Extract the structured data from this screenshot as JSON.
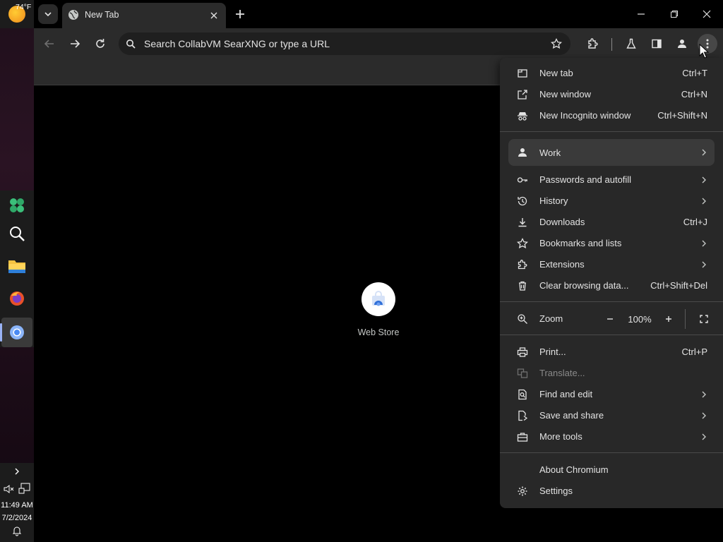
{
  "taskbar": {
    "weather_temp": "74°F",
    "time": "11:49 AM",
    "date": "7/2/2024"
  },
  "browser": {
    "tab_title": "New Tab",
    "omnibox_placeholder": "Search CollabVM SearXNG or type a URL"
  },
  "content": {
    "shortcuts": [
      {
        "label": "Web Store",
        "icon": "web-store-icon"
      }
    ]
  },
  "menu": {
    "items": [
      {
        "label": "New tab",
        "shortcut": "Ctrl+T",
        "icon": "new-tab-icon"
      },
      {
        "label": "New window",
        "shortcut": "Ctrl+N",
        "icon": "new-window-icon"
      },
      {
        "label": "New Incognito window",
        "shortcut": "Ctrl+Shift+N",
        "icon": "incognito-icon"
      },
      {
        "label": "Work",
        "icon": "person-icon",
        "submenu": true
      },
      {
        "label": "Passwords and autofill",
        "icon": "key-icon",
        "submenu": true
      },
      {
        "label": "History",
        "icon": "history-icon",
        "submenu": true
      },
      {
        "label": "Downloads",
        "shortcut": "Ctrl+J",
        "icon": "download-icon"
      },
      {
        "label": "Bookmarks and lists",
        "icon": "star-icon",
        "submenu": true
      },
      {
        "label": "Extensions",
        "icon": "puzzle-icon",
        "submenu": true
      },
      {
        "label": "Clear browsing data...",
        "shortcut": "Ctrl+Shift+Del",
        "icon": "trash-icon"
      },
      {
        "label": "Zoom",
        "icon": "zoom-icon"
      },
      {
        "label": "Print...",
        "shortcut": "Ctrl+P",
        "icon": "print-icon"
      },
      {
        "label": "Translate...",
        "icon": "translate-icon",
        "disabled": true
      },
      {
        "label": "Find and edit",
        "icon": "find-icon",
        "submenu": true
      },
      {
        "label": "Save and share",
        "icon": "save-share-icon",
        "submenu": true
      },
      {
        "label": "More tools",
        "icon": "toolbox-icon",
        "submenu": true
      },
      {
        "label": "About Chromium"
      },
      {
        "label": "Settings",
        "icon": "gear-icon"
      }
    ],
    "zoom_value": "100%"
  },
  "colors": {
    "background": "#000000",
    "toolbar": "#2b2b2b",
    "menu": "#282828",
    "menu_highlight": "#3a3a3a",
    "text": "#e3e3e3"
  }
}
